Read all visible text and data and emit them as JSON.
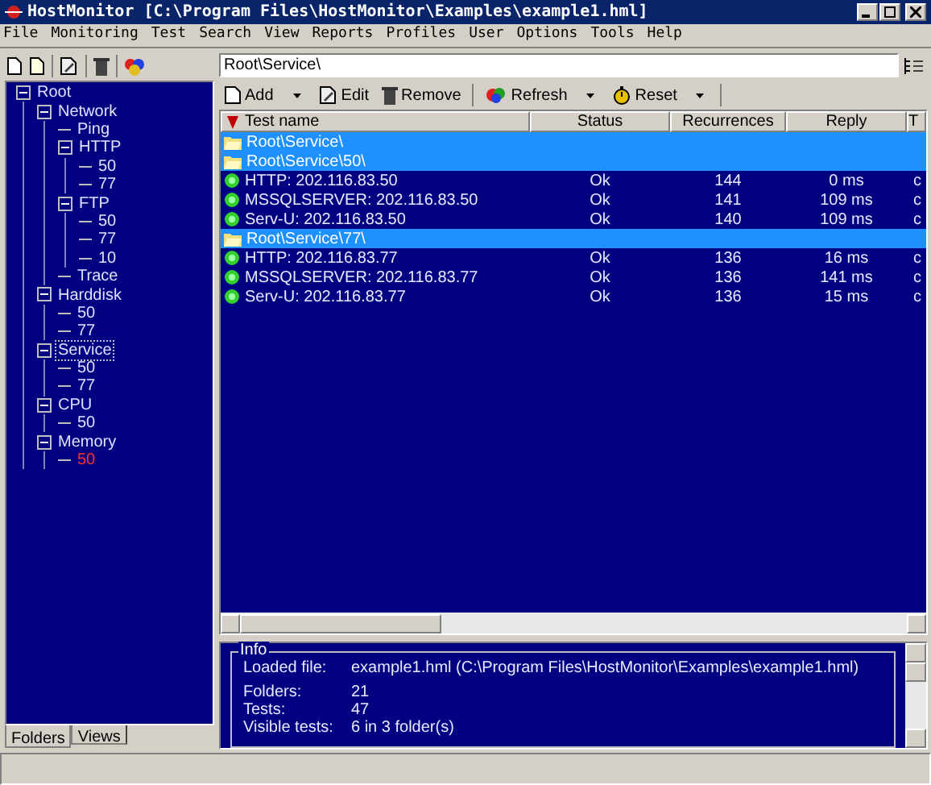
{
  "window": {
    "title": "HostMonitor  [C:\\Program Files\\HostMonitor\\Examples\\example1.hml]"
  },
  "menu": [
    "File",
    "Monitoring",
    "Test",
    "Search",
    "View",
    "Reports",
    "Profiles",
    "User",
    "Options",
    "Tools",
    "Help"
  ],
  "tree": [
    {
      "label": "Root",
      "selected": false,
      "alarm": false,
      "expanded": true,
      "children": [
        {
          "label": "Network",
          "selected": false,
          "alarm": false,
          "expanded": true,
          "children": [
            {
              "label": "Ping",
              "selected": false,
              "alarm": false
            },
            {
              "label": "HTTP",
              "selected": false,
              "alarm": false,
              "expanded": true,
              "children": [
                {
                  "label": "50",
                  "selected": false,
                  "alarm": false
                },
                {
                  "label": "77",
                  "selected": false,
                  "alarm": false
                }
              ]
            },
            {
              "label": "FTP",
              "selected": false,
              "alarm": false,
              "expanded": true,
              "children": [
                {
                  "label": "50",
                  "selected": false,
                  "alarm": false
                },
                {
                  "label": "77",
                  "selected": false,
                  "alarm": false
                },
                {
                  "label": "10",
                  "selected": false,
                  "alarm": false
                }
              ]
            },
            {
              "label": "Trace",
              "selected": false,
              "alarm": false
            }
          ]
        },
        {
          "label": "Harddisk",
          "selected": false,
          "alarm": false,
          "expanded": true,
          "children": [
            {
              "label": "50",
              "selected": false,
              "alarm": false
            },
            {
              "label": "77",
              "selected": false,
              "alarm": false
            }
          ]
        },
        {
          "label": "Service",
          "selected": true,
          "alarm": false,
          "expanded": true,
          "children": [
            {
              "label": "50",
              "selected": false,
              "alarm": false
            },
            {
              "label": "77",
              "selected": false,
              "alarm": false
            }
          ]
        },
        {
          "label": "CPU",
          "selected": false,
          "alarm": false,
          "expanded": true,
          "children": [
            {
              "label": "50",
              "selected": false,
              "alarm": false
            }
          ]
        },
        {
          "label": "Memory",
          "selected": false,
          "alarm": false,
          "expanded": true,
          "children": [
            {
              "label": "50",
              "selected": false,
              "alarm": true
            }
          ]
        }
      ]
    }
  ],
  "left_tabs": [
    {
      "label": "Folders",
      "selected": true
    },
    {
      "label": "Views",
      "selected": false
    }
  ],
  "path_field": {
    "value": "Root\\Service\\"
  },
  "toolbar": [
    {
      "label": "Add",
      "dropdown": true,
      "kind": "add"
    },
    {
      "label": "Edit",
      "dropdown": false,
      "kind": "edit"
    },
    {
      "label": "Remove",
      "dropdown": false,
      "kind": "remove"
    },
    {
      "label": "Refresh",
      "dropdown": true,
      "kind": "refresh"
    },
    {
      "label": "Reset",
      "dropdown": true,
      "kind": "reset"
    }
  ],
  "table": {
    "columns": [
      "Test name",
      "Status",
      "Recurrences",
      "Reply",
      "T"
    ],
    "rows": [
      {
        "kind": "folder",
        "name": "Root\\Service\\"
      },
      {
        "kind": "folder",
        "name": "Root\\Service\\50\\"
      },
      {
        "kind": "test",
        "name": "HTTP: 202.116.83.50",
        "status": "Ok",
        "recurrences": "144",
        "reply": "0 ms",
        "column_5": "c"
      },
      {
        "kind": "test",
        "name": "MSSQLSERVER: 202.116.83.50",
        "status": "Ok",
        "recurrences": "141",
        "reply": "109 ms",
        "column_5": "c"
      },
      {
        "kind": "test",
        "name": "Serv-U: 202.116.83.50",
        "status": "Ok",
        "recurrences": "140",
        "reply": "109 ms",
        "column_5": "c"
      },
      {
        "kind": "folder",
        "name": "Root\\Service\\77\\"
      },
      {
        "kind": "test",
        "name": "HTTP: 202.116.83.77",
        "status": "Ok",
        "recurrences": "136",
        "reply": "16 ms",
        "column_5": "c"
      },
      {
        "kind": "test",
        "name": "MSSQLSERVER: 202.116.83.77",
        "status": "Ok",
        "recurrences": "136",
        "reply": "141 ms",
        "column_5": "c"
      },
      {
        "kind": "test",
        "name": "Serv-U: 202.116.83.77",
        "status": "Ok",
        "recurrences": "136",
        "reply": "15 ms",
        "column_5": "c"
      }
    ]
  },
  "info": {
    "title": "Info",
    "rows": [
      {
        "label": "Loaded file:",
        "value": "example1.hml  (C:\\Program Files\\HostMonitor\\Examples\\example1.hml)"
      },
      {
        "label": "Folders:",
        "value": "21"
      },
      {
        "label": "Tests:",
        "value": "47"
      },
      {
        "label": "Visible tests:",
        "value": "6 in 3 folder(s)"
      }
    ]
  }
}
